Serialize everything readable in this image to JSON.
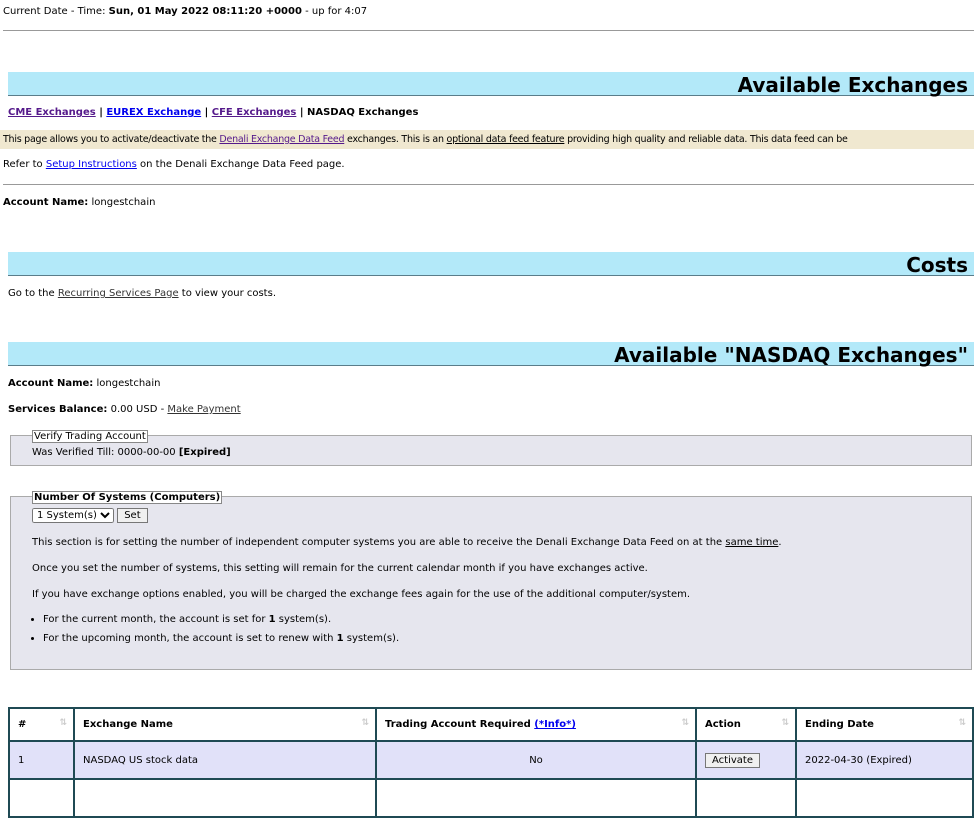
{
  "header": {
    "label": "Current Date - Time:",
    "datetime": "Sun, 01 May 2022 08:11:20 +0000",
    "uptime": "- up for 4:07"
  },
  "sections": {
    "exchanges_title": "Available Exchanges",
    "costs_title": "Costs",
    "nasdaq_title": "Available \"NASDAQ Exchanges\""
  },
  "nav": {
    "cme": "CME Exchanges",
    "eurex": "EUREX Exchange",
    "cfe": "CFE Exchanges",
    "nasdaq": "NASDAQ Exchanges",
    "sep": "|"
  },
  "intro": {
    "t1": "This page allows you to activate/deactivate the ",
    "link1": "Denali Exchange Data Feed",
    "t2": " exchanges. This is an ",
    "link2": "optional data feed feature",
    "t3": " providing high quality and reliable data. This data feed can be"
  },
  "refer": {
    "t1": "Refer to ",
    "link": "Setup Instructions",
    "t2": " on the Denali Exchange Data Feed page."
  },
  "account": {
    "label": "Account Name:",
    "value": "longestchain"
  },
  "costs": {
    "t1": "Go to the ",
    "link": "Recurring Services Page",
    "t2": " to view your costs."
  },
  "balance": {
    "label": "Services Balance:",
    "value": "0.00 USD",
    "sep": "-",
    "link": "Make Payment"
  },
  "verify": {
    "legend": "Verify Trading Account",
    "text": "Was Verified Till: 0000-00-00",
    "status": "[Expired]"
  },
  "systems": {
    "legend": "Number Of Systems (Computers)",
    "select": "1 System(s)",
    "set": "Set",
    "p1a": "This section is for setting the number of independent computer systems you are able to receive the Denali Exchange Data Feed on at the ",
    "p1link": "same time",
    "p1b": ".",
    "p2": "Once you set the number of systems, this setting will remain for the current calendar month if you have exchanges active.",
    "p3": "If you have exchange options enabled, you will be charged the exchange fees again for the use of the additional computer/system.",
    "b1a": "For the current month, the account is set for ",
    "b1n": "1",
    "b1b": " system(s).",
    "b2a": "For the upcoming month, the account is set to renew with ",
    "b2n": "1",
    "b2b": " system(s)."
  },
  "table": {
    "headers": {
      "num": "#",
      "name": "Exchange Name",
      "req": "Trading Account Required ",
      "info": "(*Info*)",
      "action": "Action",
      "end": "Ending Date"
    },
    "rows": [
      {
        "num": "1",
        "name": "NASDAQ US stock data",
        "req": "No",
        "action": "Activate",
        "end": "2022-04-30 (Expired)"
      }
    ]
  }
}
